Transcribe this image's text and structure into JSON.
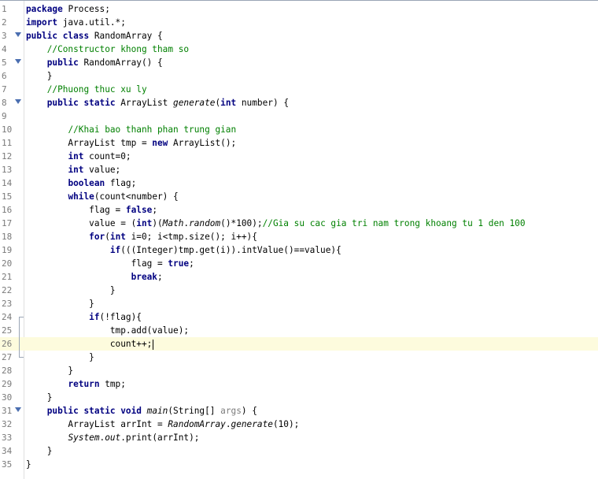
{
  "editor": {
    "lines": [
      {
        "n": "1",
        "t": "package Process;"
      },
      {
        "n": "2",
        "t": "import java.util.*;"
      },
      {
        "n": "3",
        "t": "public class RandomArray {"
      },
      {
        "n": "4",
        "t": "    //Constructor khong tham so"
      },
      {
        "n": "5",
        "t": "    public RandomArray() {"
      },
      {
        "n": "6",
        "t": "    }"
      },
      {
        "n": "7",
        "t": "    //Phuong thuc xu ly"
      },
      {
        "n": "8",
        "t": "    public static ArrayList generate(int number) {"
      },
      {
        "n": "9",
        "t": ""
      },
      {
        "n": "10",
        "t": "        //Khai bao thanh phan trung gian"
      },
      {
        "n": "11",
        "t": "        ArrayList tmp = new ArrayList();"
      },
      {
        "n": "12",
        "t": "        int count=0;"
      },
      {
        "n": "13",
        "t": "        int value;"
      },
      {
        "n": "14",
        "t": "        boolean flag;"
      },
      {
        "n": "15",
        "t": "        while(count<number) {"
      },
      {
        "n": "16",
        "t": "            flag = false;"
      },
      {
        "n": "17",
        "t": "            value = (int)(Math.random()*100);//Gia su cac gia tri nam trong khoang tu 1 den 100"
      },
      {
        "n": "18",
        "t": "            for(int i=0; i<tmp.size(); i++){"
      },
      {
        "n": "19",
        "t": "                if(((Integer)tmp.get(i)).intValue()==value){"
      },
      {
        "n": "20",
        "t": "                    flag = true;"
      },
      {
        "n": "21",
        "t": "                    break;"
      },
      {
        "n": "22",
        "t": "                }"
      },
      {
        "n": "23",
        "t": "            }"
      },
      {
        "n": "24",
        "t": "            if(!flag){"
      },
      {
        "n": "25",
        "t": "                tmp.add(value);"
      },
      {
        "n": "26",
        "t": "                count++;"
      },
      {
        "n": "27",
        "t": "            }"
      },
      {
        "n": "28",
        "t": "        }"
      },
      {
        "n": "29",
        "t": "        return tmp;"
      },
      {
        "n": "30",
        "t": "    }"
      },
      {
        "n": "31",
        "t": "    public static void main(String[] args) {"
      },
      {
        "n": "32",
        "t": "        ArrayList arrInt = RandomArray.generate(10);"
      },
      {
        "n": "33",
        "t": "        System.out.print(arrInt);"
      },
      {
        "n": "34",
        "t": "    }"
      },
      {
        "n": "35",
        "t": "}"
      }
    ]
  }
}
